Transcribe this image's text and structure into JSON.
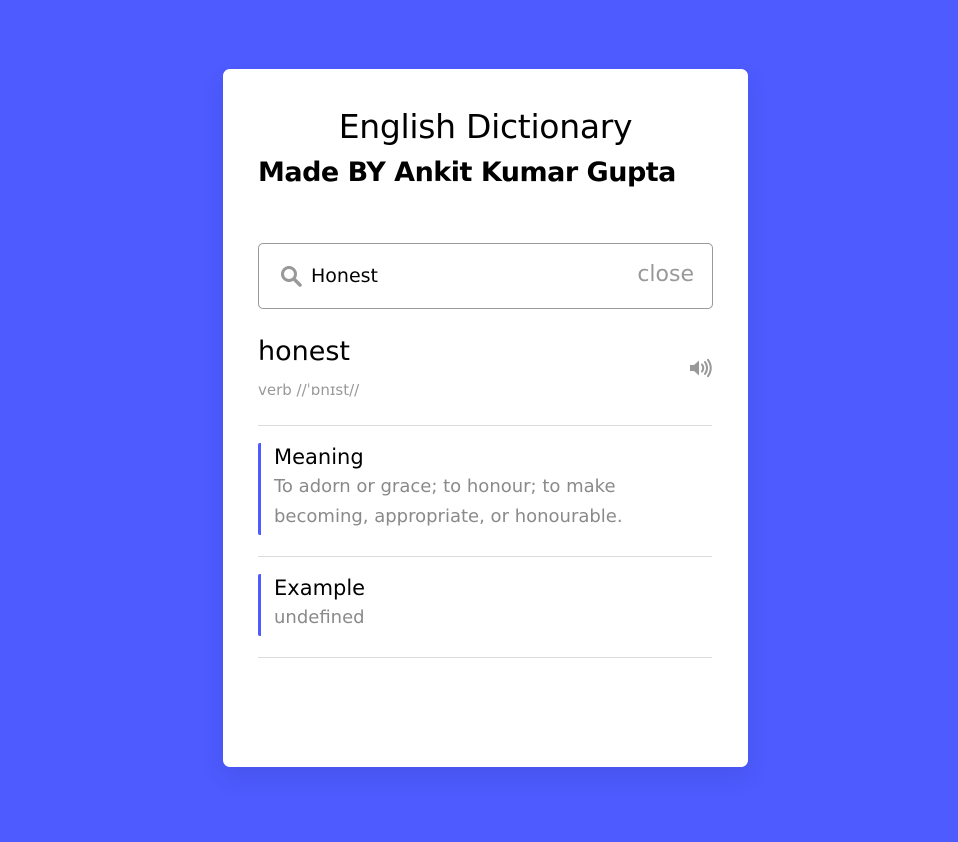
{
  "header": {
    "title": "English Dictionary",
    "subtitle": "Made BY Ankit Kumar Gupta"
  },
  "search": {
    "value": "Honest",
    "close_label": "close"
  },
  "result": {
    "word": "honest",
    "phonetic": "verb //ˈɒnɪst//",
    "meaning_label": "Meaning",
    "meaning_text": "To adorn or grace; to honour; to make becoming, appropriate, or honourable.",
    "example_label": "Example",
    "example_text": "undefined"
  },
  "icons": {
    "search": "search-icon",
    "speaker": "volume-icon"
  },
  "colors": {
    "background": "#4d5bff",
    "accent": "#4d5bff",
    "muted_text": "#8a8a8a"
  }
}
